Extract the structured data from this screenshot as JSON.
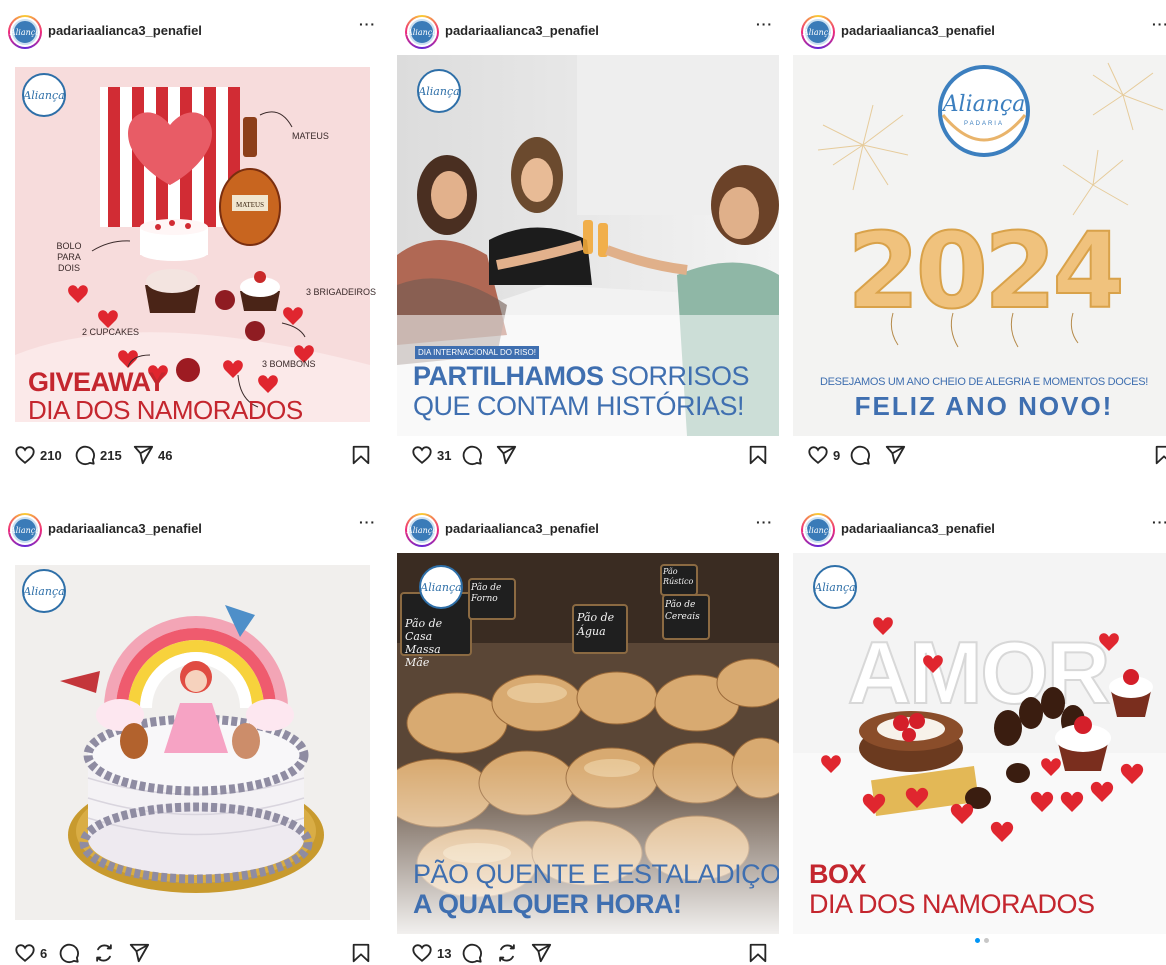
{
  "username": "padariaalianca3_penafiel",
  "more_label": "···",
  "logo_text": "Aliança",
  "posts": [
    {
      "likes": "210",
      "comments": "215",
      "shares": "46",
      "image": {
        "labels": [
          "MATEUS",
          "BOLO PARA DOIS",
          "3 BRIGADEIROS",
          "2 CUPCAKES",
          "3 BOMBONS"
        ],
        "bottle_text": "MATEUS",
        "headline": "GIVEAWAY",
        "subline": "DIA DOS NAMORADOS"
      }
    },
    {
      "likes": "31",
      "image": {
        "tag": "DIA INTERNACIONAL DO RISO!",
        "headline_bold": "PARTILHAMOS",
        "headline_rest": " SORRISOS",
        "subline": "QUE CONTAM HISTÓRIAS!"
      }
    },
    {
      "likes": "9",
      "image": {
        "year": "2024",
        "tagline": "DESEJAMOS UM ANO CHEIO DE ALEGRIA E MOMENTOS DOCES!",
        "headline": "FELIZ ANO NOVO!",
        "logo_sub": "PADARIA"
      }
    },
    {
      "likes": "6",
      "image": {}
    },
    {
      "likes": "13",
      "image": {
        "signs": [
          "Pão de Casa Massa Mãe",
          "Pão de Forno",
          "Pão de Água",
          "Pão Rústico",
          "Pão de Cereais"
        ],
        "headline": "PÃO QUENTE E ESTALADIÇO",
        "subline": "A QUALQUER HORA!"
      }
    },
    {
      "image": {
        "word": "AMOR",
        "headline": "BOX",
        "subline": "DIA DOS NAMORADOS"
      }
    }
  ],
  "colors": {
    "accent_red": "#c4262e",
    "accent_blue": "#3f6fb0",
    "gold": "#e9b46b",
    "carousel_active": "#0095f6"
  }
}
